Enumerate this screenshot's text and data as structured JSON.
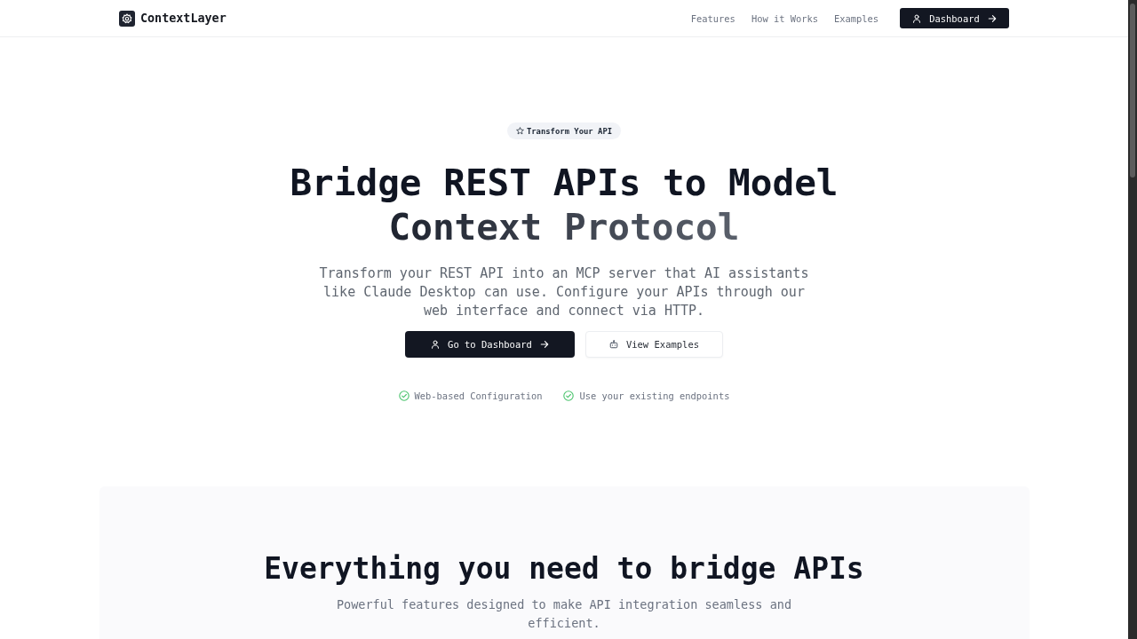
{
  "header": {
    "logo": "ContextLayer",
    "nav": [
      {
        "label": "Features"
      },
      {
        "label": "How it Works"
      },
      {
        "label": "Examples"
      }
    ],
    "cta": "Dashboard"
  },
  "hero": {
    "badge": "Transform Your API",
    "title": "Bridge REST APIs to Model",
    "title_highlight": "Context Protocol",
    "subtitle": "Transform your REST API into an MCP server that AI assistants like Claude Desktop can use. Configure your APIs through our web interface and connect via HTTP.",
    "buttons": [
      {
        "label": "Go to Dashboard",
        "kind": "primary"
      },
      {
        "label": "View Examples",
        "kind": "secondary"
      }
    ],
    "highlights": [
      "Web-based Configuration",
      "Use your existing endpoints"
    ]
  },
  "features": {
    "title": "Everything you need to bridge APIs",
    "subtitle": "Powerful features designed to make API integration seamless and efficient."
  }
}
